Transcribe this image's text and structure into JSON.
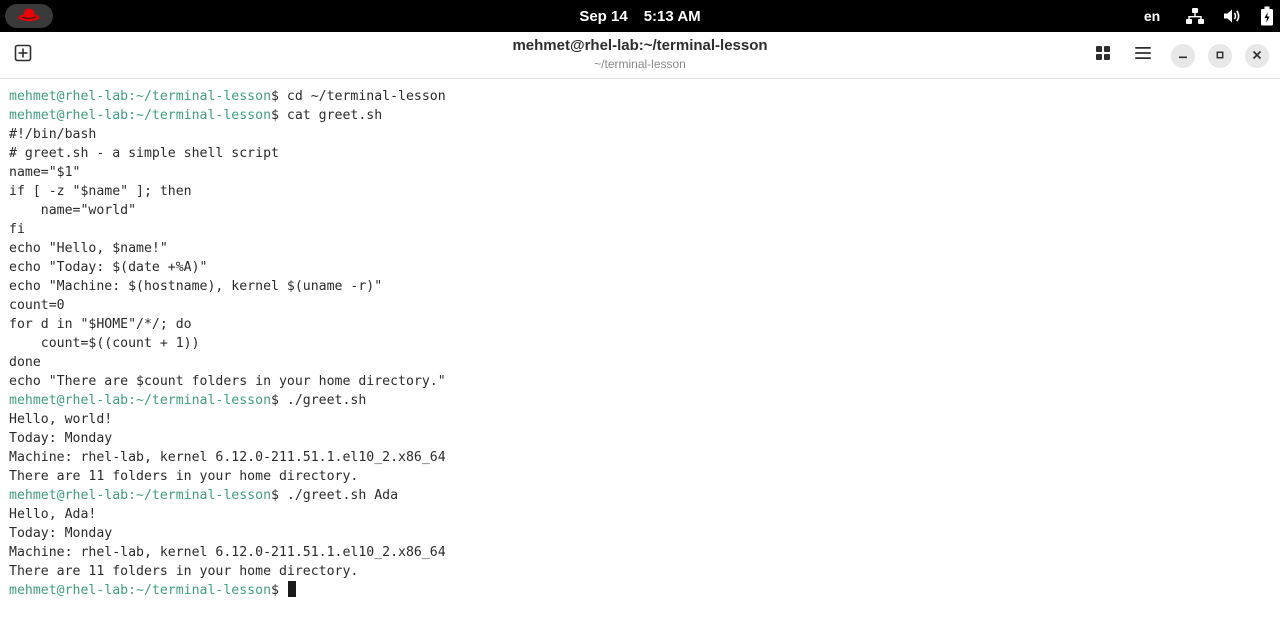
{
  "topbar": {
    "activities_icon": "redhat-logo-icon",
    "date": "Sep 14",
    "time": "5:13 AM",
    "language": "en",
    "status_icons": [
      "network-icon",
      "volume-icon",
      "battery-icon"
    ]
  },
  "window": {
    "title": "mehmet@rhel-lab:~/terminal-lesson",
    "subtitle": "~/terminal-lesson",
    "buttons": [
      "new-tab-icon",
      "tab-overview-icon",
      "menu-icon",
      "minimize-icon",
      "maximize-icon",
      "close-icon"
    ]
  },
  "terminal": {
    "prompt": "mehmet@rhel-lab:~/terminal-lesson",
    "lines": [
      {
        "prompt": "mehmet@rhel-lab:~/terminal-lesson",
        "text": "$ cd ~/terminal-lesson"
      },
      {
        "prompt": "mehmet@rhel-lab:~/terminal-lesson",
        "text": "$ cat greet.sh"
      },
      {
        "prompt": "",
        "text": "#!/bin/bash"
      },
      {
        "prompt": "",
        "text": "# greet.sh - a simple shell script"
      },
      {
        "prompt": "",
        "text": "name=\"$1\""
      },
      {
        "prompt": "",
        "text": "if [ -z \"$name\" ]; then"
      },
      {
        "prompt": "",
        "text": "    name=\"world\""
      },
      {
        "prompt": "",
        "text": "fi"
      },
      {
        "prompt": "",
        "text": "echo \"Hello, $name!\""
      },
      {
        "prompt": "",
        "text": "echo \"Today: $(date +%A)\""
      },
      {
        "prompt": "",
        "text": "echo \"Machine: $(hostname), kernel $(uname -r)\""
      },
      {
        "prompt": "",
        "text": "count=0"
      },
      {
        "prompt": "",
        "text": "for d in \"$HOME\"/*/; do"
      },
      {
        "prompt": "",
        "text": "    count=$((count + 1))"
      },
      {
        "prompt": "",
        "text": "done"
      },
      {
        "prompt": "",
        "text": "echo \"There are $count folders in your home directory.\""
      },
      {
        "prompt": "mehmet@rhel-lab:~/terminal-lesson",
        "text": "$ ./greet.sh"
      },
      {
        "prompt": "",
        "text": "Hello, world!"
      },
      {
        "prompt": "",
        "text": "Today: Monday"
      },
      {
        "prompt": "",
        "text": "Machine: rhel-lab, kernel 6.12.0-211.51.1.el10_2.x86_64"
      },
      {
        "prompt": "",
        "text": "There are 11 folders in your home directory."
      },
      {
        "prompt": "mehmet@rhel-lab:~/terminal-lesson",
        "text": "$ ./greet.sh Ada"
      },
      {
        "prompt": "",
        "text": "Hello, Ada!"
      },
      {
        "prompt": "",
        "text": "Today: Monday"
      },
      {
        "prompt": "",
        "text": "Machine: rhel-lab, kernel 6.12.0-211.51.1.el10_2.x86_64"
      },
      {
        "prompt": "",
        "text": "There are 11 folders in your home directory."
      },
      {
        "prompt": "mehmet@rhel-lab:~/terminal-lesson",
        "text": "$ "
      }
    ]
  },
  "colors": {
    "prompt": "#3f9f7f",
    "text": "#2b2b2b",
    "topbar": "#000000",
    "redhat": "#ee0000"
  }
}
